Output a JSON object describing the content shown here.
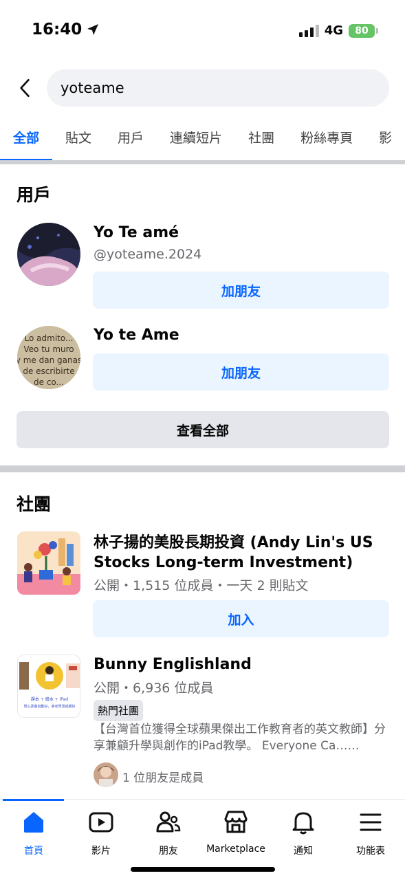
{
  "status_bar": {
    "time": "16:40",
    "network": "4G",
    "battery": "80"
  },
  "search": {
    "query": "yoteame"
  },
  "tabs": [
    {
      "label": "全部"
    },
    {
      "label": "貼文"
    },
    {
      "label": "用戶"
    },
    {
      "label": "連續短片"
    },
    {
      "label": "社團"
    },
    {
      "label": "粉絲專頁"
    },
    {
      "label": "影"
    }
  ],
  "users_section": {
    "title": "用戶",
    "users": [
      {
        "name": "Yo Te amé",
        "handle": "@yoteame.2024",
        "button": "加朋友"
      },
      {
        "name": "Yo te Ame",
        "button": "加朋友",
        "avatar_text": "Lo admito...\nVeo tu muro\ny me dan ganas\nde escribirte\nde co..."
      }
    ],
    "see_all": "查看全部"
  },
  "groups_section": {
    "title": "社團",
    "groups": [
      {
        "name": "林子揚的美股長期投資 (Andy Lin's US Stocks Long-term Investment)",
        "meta": "公開・1,515 位成員・一天 2 則貼文",
        "button": "加入"
      },
      {
        "name": "Bunny Englishland",
        "meta": "公開・6,936 位成員",
        "badge": "熱門社團",
        "description": "【台灣首位獲得全球蘋果傑出工作教育者的英文教師】分享兼顧升學與創作的iPad教學。 Everyone Ca……",
        "friends": "1 位朋友是成員",
        "thumb_caption": "課本 + 繪本 + iPad",
        "thumb_caption2": "想心素養自動好，會考學測成績好"
      }
    ]
  },
  "bottom_nav": [
    {
      "label": "首頁",
      "icon": "home-icon"
    },
    {
      "label": "影片",
      "icon": "video-icon"
    },
    {
      "label": "朋友",
      "icon": "friends-icon"
    },
    {
      "label": "Marketplace",
      "icon": "marketplace-icon"
    },
    {
      "label": "通知",
      "icon": "bell-icon"
    },
    {
      "label": "功能表",
      "icon": "menu-icon"
    }
  ],
  "colors": {
    "accent": "#0866ff",
    "light_blue": "#ebf5ff",
    "gray_button": "#e4e6eb",
    "battery": "#65c466"
  }
}
